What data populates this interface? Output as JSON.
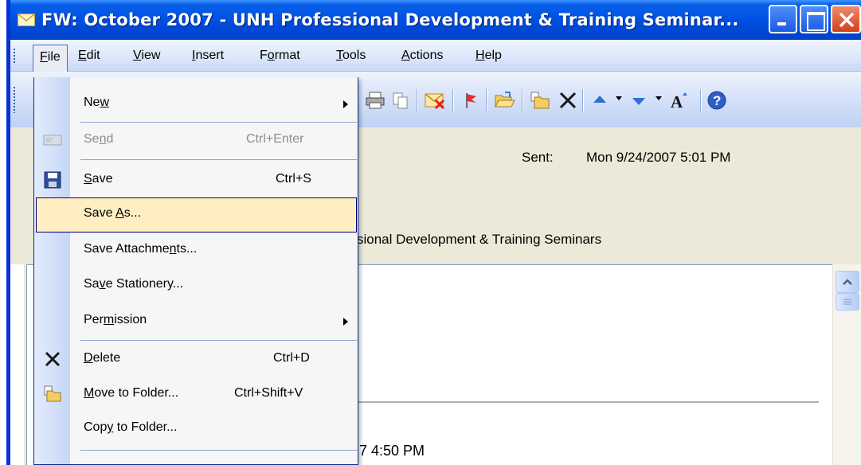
{
  "window": {
    "title": "FW: October 2007 - UNH Professional Development & Training Seminar..."
  },
  "menubar": {
    "items": [
      {
        "label": "File",
        "ul": "F",
        "rest": "ile"
      },
      {
        "label": "Edit",
        "ul": "E",
        "rest": "dit"
      },
      {
        "label": "View",
        "ul": "V",
        "rest": "iew"
      },
      {
        "label": "Insert",
        "ul": "I",
        "rest": "nsert"
      },
      {
        "label": "Format",
        "pre": "F",
        "ul": "o",
        "rest": "rmat"
      },
      {
        "label": "Tools",
        "ul": "T",
        "rest": "ools"
      },
      {
        "label": "Actions",
        "ul": "A",
        "rest": "ctions"
      },
      {
        "label": "Help",
        "ul": "H",
        "rest": "elp"
      }
    ]
  },
  "message": {
    "sent_label": "Sent:",
    "sent_value": "Mon 9/24/2007 5:01 PM",
    "subject_fragment": "sional Development & Training Seminars",
    "body_time_fragment": "7 4:50 PM"
  },
  "file_menu": {
    "items": [
      {
        "pre": "Ne",
        "ul": "w",
        "post": "",
        "shortcut": "",
        "submenu": true,
        "disabled": false
      },
      {
        "pre": "Se",
        "ul": "n",
        "post": "d",
        "shortcut": "Ctrl+Enter",
        "submenu": false,
        "disabled": true
      },
      {
        "pre": "",
        "ul": "S",
        "post": "ave",
        "shortcut": "Ctrl+S",
        "submenu": false,
        "disabled": false
      },
      {
        "pre": "Save ",
        "ul": "A",
        "post": "s...",
        "shortcut": "",
        "submenu": false,
        "disabled": false,
        "highlighted": true
      },
      {
        "pre": "Save Attachme",
        "ul": "n",
        "post": "ts...",
        "shortcut": "",
        "submenu": false,
        "disabled": false
      },
      {
        "pre": "Sa",
        "ul": "v",
        "post": "e Stationery...",
        "shortcut": "",
        "submenu": false,
        "disabled": false
      },
      {
        "pre": "Per",
        "ul": "m",
        "post": "ission",
        "shortcut": "",
        "submenu": true,
        "disabled": false
      },
      {
        "pre": "",
        "ul": "D",
        "post": "elete",
        "shortcut": "Ctrl+D",
        "submenu": false,
        "disabled": false
      },
      {
        "pre": "",
        "ul": "M",
        "post": "ove to Folder...",
        "shortcut": "Ctrl+Shift+V",
        "submenu": false,
        "disabled": false
      },
      {
        "pre": "Cop",
        "ul": "y",
        "post": " to Folder...",
        "shortcut": "",
        "submenu": false,
        "disabled": false
      }
    ]
  },
  "colors": {
    "titlebar": "#0055e5",
    "menu_highlight": "#ffeec2",
    "menu_highlight_border": "#000080",
    "header_bg": "#ece9d8"
  },
  "icons": {
    "title": "envelope-icon",
    "toolbar": [
      "print-icon",
      "copy-icon",
      "mark-unread-icon",
      "flag-icon",
      "open-folder-icon",
      "move-to-folder-icon",
      "delete-icon",
      "previous-item-icon",
      "next-item-icon",
      "font-size-icon",
      "help-icon"
    ],
    "file_menu": [
      "send-icon",
      "save-icon",
      "delete-icon",
      "move-to-folder-icon"
    ]
  }
}
